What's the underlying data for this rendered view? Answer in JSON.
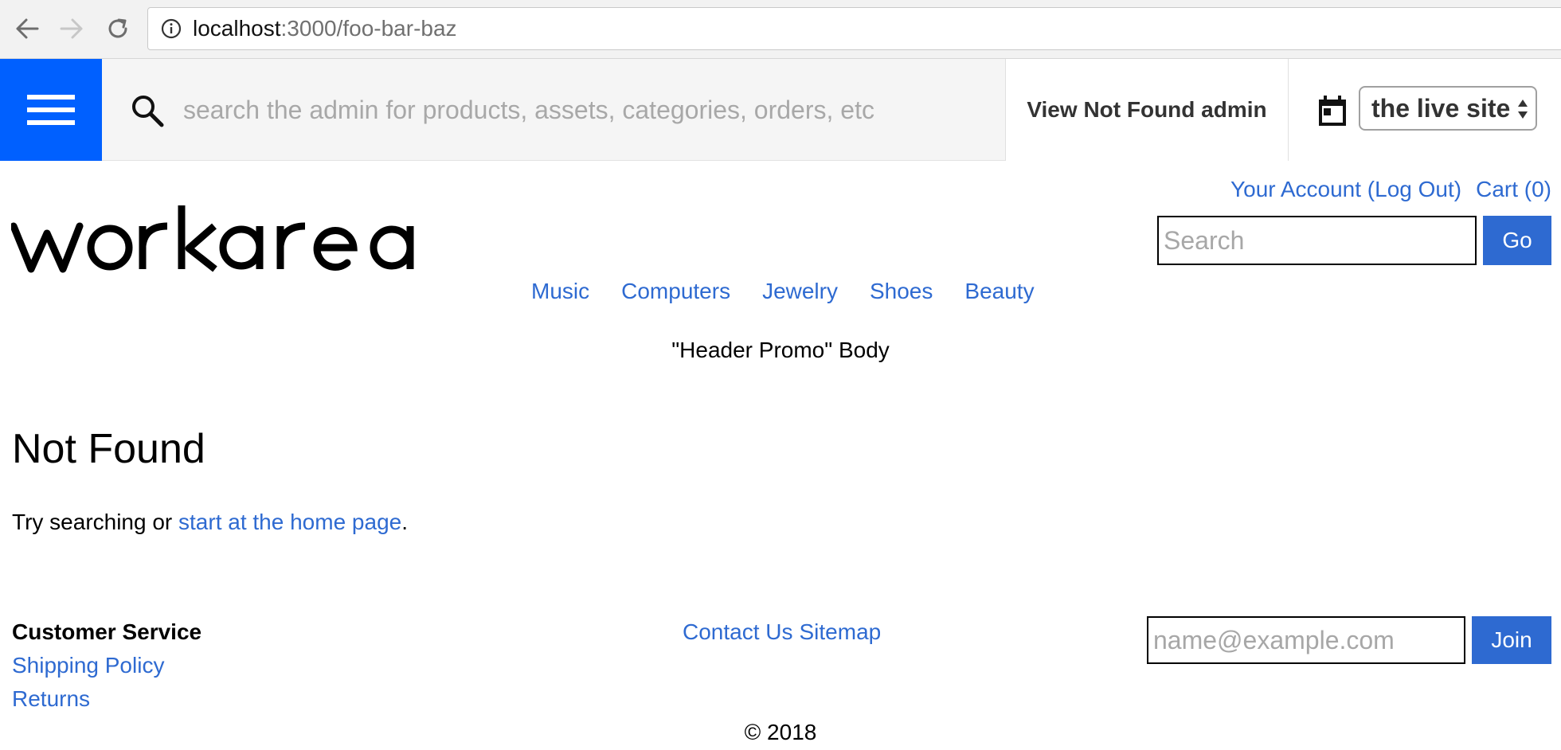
{
  "browser": {
    "url_host": "localhost",
    "url_rest": ":3000/foo-bar-baz",
    "icons": [
      "back-icon",
      "forward-icon",
      "reload-icon",
      "info-icon"
    ]
  },
  "admin_toolbar": {
    "search_placeholder": "search the admin for products, assets, categories, orders, etc",
    "view_admin_label": "View Not Found admin",
    "release_selected": "the live site",
    "accent_color": "#0060ff",
    "icons": [
      "menu-icon",
      "search-icon",
      "calendar-icon"
    ]
  },
  "header": {
    "logo_text": "workarea",
    "account_link": "Your Account (Log Out)",
    "cart_link": "Cart (0)",
    "search_placeholder": "Search",
    "search_button": "Go",
    "nav": [
      "Music",
      "Computers",
      "Jewelry",
      "Shoes",
      "Beauty"
    ],
    "promo": "\"Header Promo\" Body"
  },
  "main": {
    "title": "Not Found",
    "body_prefix": "Try searching or ",
    "home_link": "start at the home page",
    "body_suffix": "."
  },
  "footer": {
    "heading": "Customer Service",
    "links": [
      "Shipping Policy",
      "Returns"
    ],
    "center_links": [
      "Contact Us",
      "Sitemap"
    ],
    "email_placeholder": "name@example.com",
    "join_button": "Join",
    "copyright": "© 2018"
  },
  "colors": {
    "link": "#2e6ad1",
    "button": "#2e6ad1"
  }
}
